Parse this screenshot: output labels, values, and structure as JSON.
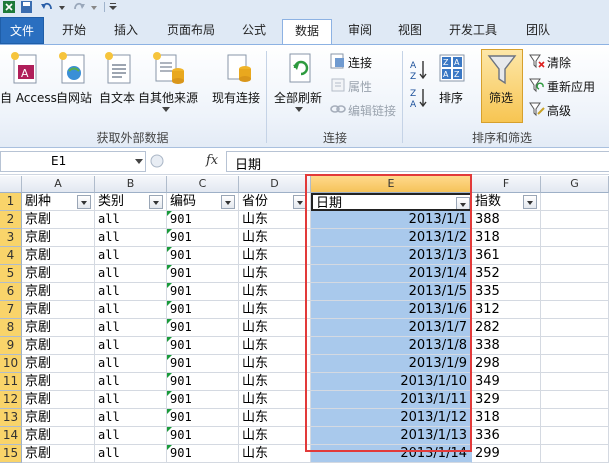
{
  "tabs": [
    "文件",
    "开始",
    "插入",
    "页面布局",
    "公式",
    "数据",
    "审阅",
    "视图",
    "开发工具",
    "团队"
  ],
  "active_tab": "数据",
  "ribbon": {
    "ext_data": {
      "access": "自 Access",
      "web": "自网站",
      "text": "自文本",
      "other": "自其他来源",
      "existing": "现有连接",
      "group": "获取外部数据"
    },
    "connections": {
      "refresh": "全部刷新",
      "conn": "连接",
      "props": "属性",
      "edit_links": "编辑链接",
      "group": "连接"
    },
    "sort": {
      "sort": "排序",
      "filter": "筛选",
      "clear": "清除",
      "reapply": "重新应用",
      "advanced": "高级",
      "group": "排序和筛选"
    }
  },
  "formula_bar": {
    "name_box": "E1",
    "fx": "fx",
    "content": "日期"
  },
  "columns": [
    "A",
    "B",
    "C",
    "D",
    "E",
    "F",
    "G"
  ],
  "headers": [
    "剧种",
    "类别",
    "编码",
    "省份",
    "日期",
    "指数"
  ],
  "rows": [
    {
      "n": "1",
      "a": "剧种",
      "b": "类别",
      "c": "编码",
      "d": "省份",
      "e": "日期",
      "f": "指数"
    },
    {
      "n": "2",
      "a": "京剧",
      "b": "all",
      "c": "901",
      "d": "山东",
      "e": "2013/1/1",
      "f": "388"
    },
    {
      "n": "3",
      "a": "京剧",
      "b": "all",
      "c": "901",
      "d": "山东",
      "e": "2013/1/2",
      "f": "318"
    },
    {
      "n": "4",
      "a": "京剧",
      "b": "all",
      "c": "901",
      "d": "山东",
      "e": "2013/1/3",
      "f": "361"
    },
    {
      "n": "5",
      "a": "京剧",
      "b": "all",
      "c": "901",
      "d": "山东",
      "e": "2013/1/4",
      "f": "352"
    },
    {
      "n": "6",
      "a": "京剧",
      "b": "all",
      "c": "901",
      "d": "山东",
      "e": "2013/1/5",
      "f": "335"
    },
    {
      "n": "7",
      "a": "京剧",
      "b": "all",
      "c": "901",
      "d": "山东",
      "e": "2013/1/6",
      "f": "312"
    },
    {
      "n": "8",
      "a": "京剧",
      "b": "all",
      "c": "901",
      "d": "山东",
      "e": "2013/1/7",
      "f": "282"
    },
    {
      "n": "9",
      "a": "京剧",
      "b": "all",
      "c": "901",
      "d": "山东",
      "e": "2013/1/8",
      "f": "338"
    },
    {
      "n": "10",
      "a": "京剧",
      "b": "all",
      "c": "901",
      "d": "山东",
      "e": "2013/1/9",
      "f": "298"
    },
    {
      "n": "11",
      "a": "京剧",
      "b": "all",
      "c": "901",
      "d": "山东",
      "e": "2013/1/10",
      "f": "349"
    },
    {
      "n": "12",
      "a": "京剧",
      "b": "all",
      "c": "901",
      "d": "山东",
      "e": "2013/1/11",
      "f": "329"
    },
    {
      "n": "13",
      "a": "京剧",
      "b": "all",
      "c": "901",
      "d": "山东",
      "e": "2013/1/12",
      "f": "318"
    },
    {
      "n": "14",
      "a": "京剧",
      "b": "all",
      "c": "901",
      "d": "山东",
      "e": "2013/1/13",
      "f": "336"
    },
    {
      "n": "15",
      "a": "京剧",
      "b": "all",
      "c": "901",
      "d": "山东",
      "e": "2013/1/14",
      "f": "299"
    }
  ],
  "colors": {
    "accent": "#2a6fc0",
    "selection": "#a9c9ec",
    "highlight_border": "#e23a3a",
    "row_header_highlight": "#f9d46a"
  }
}
